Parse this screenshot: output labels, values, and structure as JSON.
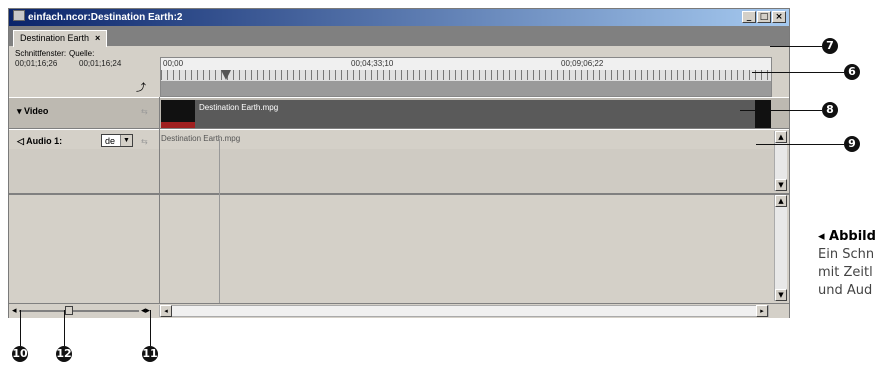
{
  "window": {
    "title": "einfach.ncor:Destination Earth:2",
    "buttons": [
      "_",
      "□",
      "×"
    ]
  },
  "tab": {
    "label": "Destination Earth",
    "close": "×"
  },
  "timecodes": {
    "cutter_label": "Schnittfenster:",
    "cutter_value": "00;01;16;26",
    "source_label": "Quelle:",
    "source_value": "00;01;16;24"
  },
  "ruler": {
    "marks": [
      "00;00",
      "00;04;33;10",
      "00;09;06;22"
    ]
  },
  "tracks": {
    "video": {
      "label": "Video",
      "clip": "Destination Earth.mpg"
    },
    "audio": {
      "label": "Audio 1:",
      "language": "de",
      "clip": "Destination Earth.mpg"
    }
  },
  "callouts": [
    "6",
    "7",
    "8",
    "9",
    "10",
    "11",
    "12"
  ],
  "caption": {
    "head": "◂ Abbild",
    "line1": "Ein Schn",
    "line2": "mit Zeitl",
    "line3": "und Aud"
  }
}
